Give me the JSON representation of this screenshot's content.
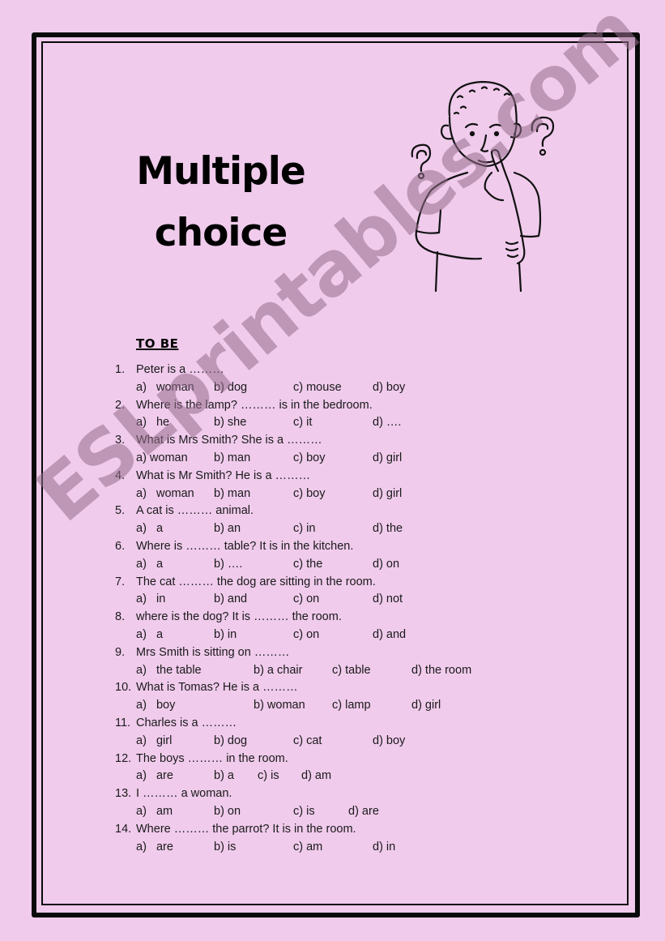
{
  "title": {
    "line1": "Multiple",
    "line2": "choice"
  },
  "section": "TO BE",
  "watermark": "ESLprintables.com",
  "questions": [
    {
      "num": "1.",
      "text": "Peter is a ………",
      "options": [
        "a)   woman",
        "b) dog",
        "c) mouse",
        "d) boy"
      ],
      "layout": "std"
    },
    {
      "num": "2.",
      "text": "Where is the lamp? ……… is in the bedroom.",
      "options": [
        "a)   he",
        "b) she",
        "c) it",
        "d) …."
      ],
      "layout": "std"
    },
    {
      "num": "3.",
      "text": "What is Mrs Smith? She is a ………",
      "options": [
        "a) woman",
        "b) man",
        "c) boy",
        "d) girl"
      ],
      "layout": "std"
    },
    {
      "num": "4.",
      "text": "What is Mr Smith? He is a ………",
      "options": [
        "a)   woman",
        "b) man",
        "c) boy",
        "d) girl"
      ],
      "layout": "std"
    },
    {
      "num": "5.",
      "text": "A cat is ……… animal.",
      "options": [
        "a)   a",
        "b) an",
        "c) in",
        "d) the"
      ],
      "layout": "std"
    },
    {
      "num": "6.",
      "text": "Where is ……… table? It is in the kitchen.",
      "options": [
        "a)   a",
        "b) ….",
        "c) the",
        "d) on"
      ],
      "layout": "std"
    },
    {
      "num": "7.",
      "text": "The cat ……… the dog are sitting in the room.",
      "options": [
        "a)   in",
        "b) and",
        "c) on",
        "d) not"
      ],
      "layout": "std"
    },
    {
      "num": "8.",
      "text": "where is the dog? It is ……… the room.",
      "options": [
        "a)   a",
        "b) in",
        "c) on",
        "d) and"
      ],
      "layout": "std"
    },
    {
      "num": "9.",
      "text": "Mrs Smith is sitting on ………",
      "options": [
        "a)   the table",
        "b) a chair",
        "c) table",
        "d) the room"
      ],
      "layout": "wide"
    },
    {
      "num": "10.",
      "text": "What is Tomas? He is a ………",
      "options": [
        "a)   boy",
        "b) woman",
        "c) lamp",
        "d) girl"
      ],
      "layout": "wide"
    },
    {
      "num": "11.",
      "text": "Charles is a ………",
      "options": [
        "a)   girl",
        "b) dog",
        "c) cat",
        "d) boy"
      ],
      "layout": "std"
    },
    {
      "num": "12.",
      "text": "The boys ……… in the room.",
      "options": [
        "a)   are",
        "b) a",
        "c) is",
        "d) am"
      ],
      "layout": "tight"
    },
    {
      "num": "13.",
      "text": "I ……… a woman.",
      "options": [
        "a)   am",
        "b) on",
        "c) is",
        "d) are"
      ],
      "layout": "mid"
    },
    {
      "num": "14.",
      "text": "Where ……… the parrot? It is in the room.",
      "options": [
        "a)   are",
        "b) is",
        "c) am",
        "d) in"
      ],
      "layout": "std"
    }
  ]
}
